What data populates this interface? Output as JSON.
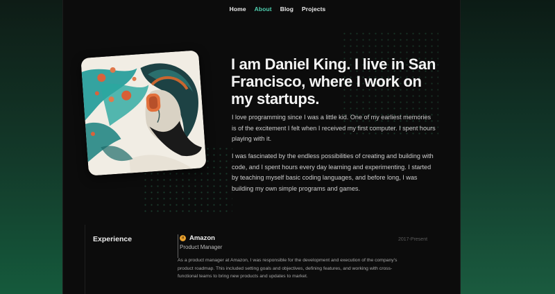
{
  "nav": {
    "items": [
      {
        "label": "Home",
        "active": false
      },
      {
        "label": "About",
        "active": true
      },
      {
        "label": "Blog",
        "active": false
      },
      {
        "label": "Projects",
        "active": false
      }
    ]
  },
  "hero": {
    "title": "I am Daniel King. I live in San Francisco, where I work on my startups.",
    "paragraphs": [
      "I love programming since I was a little kid. One of my earliest memories is of the excitement I felt when I received my first computer. I spent hours playing with it.",
      "I was fascinated by the endless possibilities of creating and building with code, and I spent hours every day learning and experimenting. I started by teaching myself basic coding languages, and before long, I was building my own simple programs and games."
    ],
    "portrait_icon": "illustrated-portrait-man-with-headphones"
  },
  "experience": {
    "section_title": "Experience",
    "items": [
      {
        "company": "Amazon",
        "company_icon": "amazon-logo-icon",
        "company_icon_glyph": "a",
        "role": "Product Manager",
        "period": "2017-Present",
        "description": "As a product manager at Amazon, I was responsible for the development and execution of the company's product roadmap. This included setting goals and objectives, defining features, and working with cross-functional teams to bring new products and updates to market."
      }
    ]
  },
  "colors": {
    "accent": "#4fd0b0",
    "background": "#0c0c0c",
    "company_icon": "#e9a12f"
  }
}
